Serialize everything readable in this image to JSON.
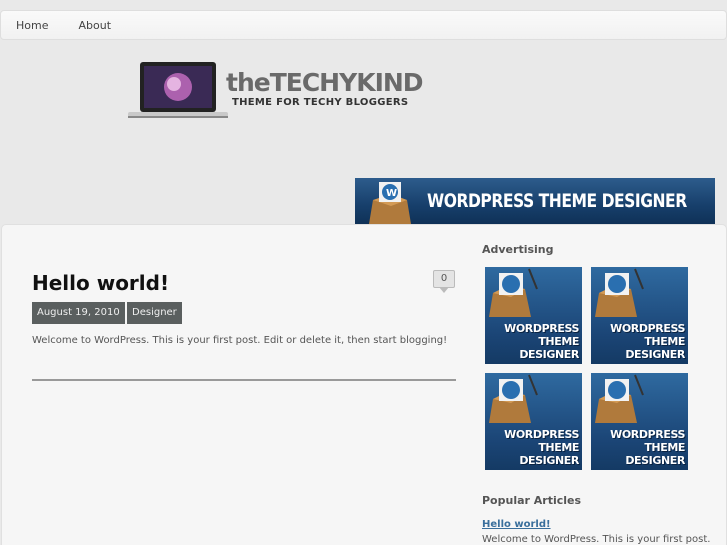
{
  "nav": {
    "items": [
      {
        "label": "Home"
      },
      {
        "label": "About"
      }
    ]
  },
  "header": {
    "brand": "theTECHYKIND",
    "tagline": "THEME FOR TECHY BLOGGERS",
    "banner_text": "WORDPRESS THEME DESIGNER"
  },
  "post": {
    "title": "Hello world!",
    "comment_count": "0",
    "date": "August 19, 2010",
    "category": "Designer",
    "excerpt": "Welcome to WordPress. This is your first post. Edit or delete it, then start blogging!"
  },
  "sidebar": {
    "advertising_heading": "Advertising",
    "ads": [
      {
        "line1": "WORDPRESS",
        "line2": "THEME",
        "line3": "DESIGNER"
      },
      {
        "line1": "WORDPRESS",
        "line2": "THEME",
        "line3": "DESIGNER"
      },
      {
        "line1": "WORDPRESS",
        "line2": "THEME",
        "line3": "DESIGNER"
      },
      {
        "line1": "WORDPRESS",
        "line2": "THEME",
        "line3": "DESIGNER"
      }
    ],
    "popular_heading": "Popular Articles",
    "popular": [
      {
        "title": "Hello world!",
        "excerpt": "Welcome to WordPress. This is your first post."
      }
    ]
  },
  "colors": {
    "accent_blue": "#1b4576",
    "tag_bg": "#5a5f5f",
    "link": "#3a6f9c"
  }
}
